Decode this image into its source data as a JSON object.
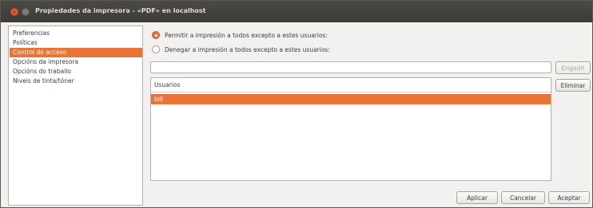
{
  "window": {
    "title": "Propiedades da impresora - «PDF» en localhost",
    "close_glyph": "×"
  },
  "sidebar": {
    "items": [
      {
        "label": "Preferencias",
        "selected": false
      },
      {
        "label": "Políticas",
        "selected": false
      },
      {
        "label": "Control de acceso",
        "selected": true
      },
      {
        "label": "Opcións da impresora",
        "selected": false
      },
      {
        "label": "Opcións do traballo",
        "selected": false
      },
      {
        "label": "Niveis de tinta/tóner",
        "selected": false
      }
    ]
  },
  "access": {
    "allow_label": "Permitir a impresión a todos excepto a estes usuarios:",
    "deny_label": "Denegar a impresión a todos excepto a estes usuarios:",
    "selected_option": "allow",
    "user_entry_value": "",
    "add_button": "Engadir",
    "remove_button": "Eliminar",
    "list_header": "Usuarios",
    "users": [
      {
        "name": "bill",
        "selected": true
      }
    ]
  },
  "footer": {
    "apply": "Aplicar",
    "cancel": "Cancelar",
    "accept": "Aceptar"
  },
  "colors": {
    "accent": "#e9743a",
    "titlebar": "#3c3b37"
  }
}
